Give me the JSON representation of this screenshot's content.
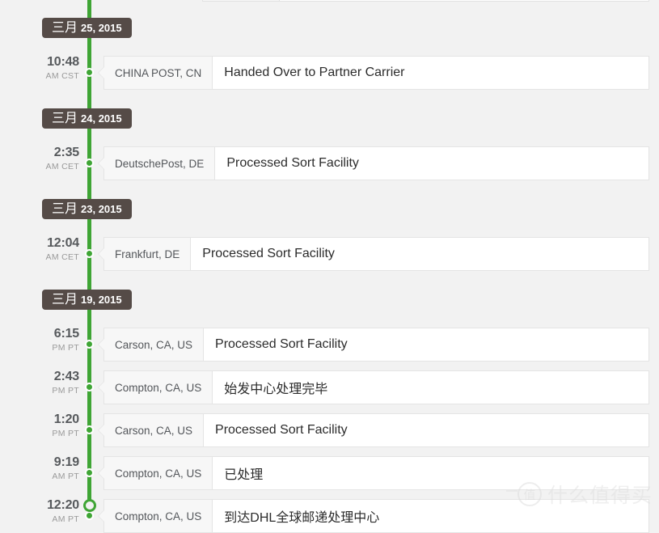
{
  "timeline": {
    "accent_color": "#3fa535",
    "badge_color": "#554b47",
    "background_color": "#f2f2f2",
    "groups": [
      {
        "date_month": "三月",
        "date_rest": "25, 2015",
        "events": [
          {
            "time": "10:48",
            "zone": "AM CST",
            "location": "CHINA POST, CN",
            "description": "Handed Over to Partner Carrier",
            "cjk": false
          }
        ]
      },
      {
        "date_month": "三月",
        "date_rest": "24, 2015",
        "events": [
          {
            "time": "2:35",
            "zone": "AM CET",
            "location": "DeutschePost, DE",
            "description": "Processed Sort Facility",
            "cjk": false
          }
        ]
      },
      {
        "date_month": "三月",
        "date_rest": "23, 2015",
        "events": [
          {
            "time": "12:04",
            "zone": "AM CET",
            "location": "Frankfurt, DE",
            "description": "Processed Sort Facility",
            "cjk": false
          }
        ]
      },
      {
        "date_month": "三月",
        "date_rest": "19, 2015",
        "events": [
          {
            "time": "6:15",
            "zone": "PM PT",
            "location": "Carson, CA, US",
            "description": "Processed Sort Facility",
            "cjk": false
          },
          {
            "time": "2:43",
            "zone": "PM PT",
            "location": "Compton, CA, US",
            "description": "始发中心处理完毕",
            "cjk": true
          },
          {
            "time": "1:20",
            "zone": "PM PT",
            "location": "Carson, CA, US",
            "description": "Processed Sort Facility",
            "cjk": false
          },
          {
            "time": "9:19",
            "zone": "AM PT",
            "location": "Compton, CA, US",
            "description": "已处理",
            "cjk": true
          },
          {
            "time": "12:20",
            "zone": "AM PT",
            "location": "Compton, CA, US",
            "description": "到达DHL全球邮递处理中心",
            "cjk": true
          }
        ]
      }
    ]
  },
  "watermark": {
    "badge_glyph": "值",
    "text": "什么值得买"
  }
}
